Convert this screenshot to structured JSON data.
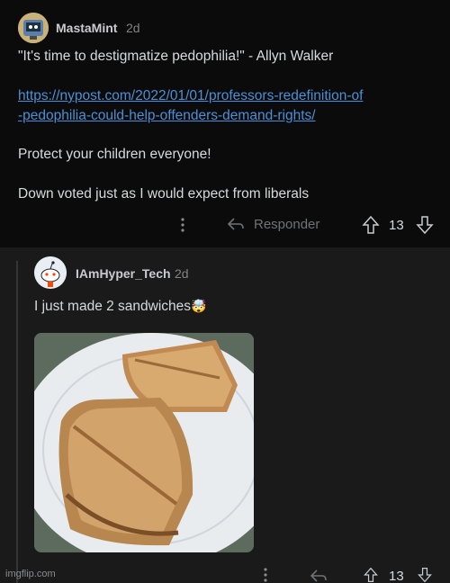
{
  "comment1": {
    "username": "MastaMint",
    "age": "2d",
    "line1": "\"It's time to destigmatize pedophilia!\" - Allyn Walker",
    "link_line1": "https://nypost.com/2022/01/01/professors-redefinition-of",
    "link_line2": "-pedophilia-could-help-offenders-demand-rights/",
    "line2": "Protect your children everyone!",
    "line3": "Down voted just as I would expect from liberals",
    "reply_label": "Responder",
    "score": "13"
  },
  "comment2": {
    "username": "IAmHyper_Tech",
    "age": "2d",
    "text": "I just made 2 sandwiches",
    "emoji": "🤯",
    "score": "13"
  },
  "watermark": "imgflip.com",
  "icons": {
    "more": "more-options-icon",
    "reply": "reply-icon",
    "upvote": "upvote-icon",
    "downvote": "downvote-icon"
  },
  "colors": {
    "link": "#4a90d9",
    "text": "#d7dadc",
    "muted": "#818384"
  }
}
